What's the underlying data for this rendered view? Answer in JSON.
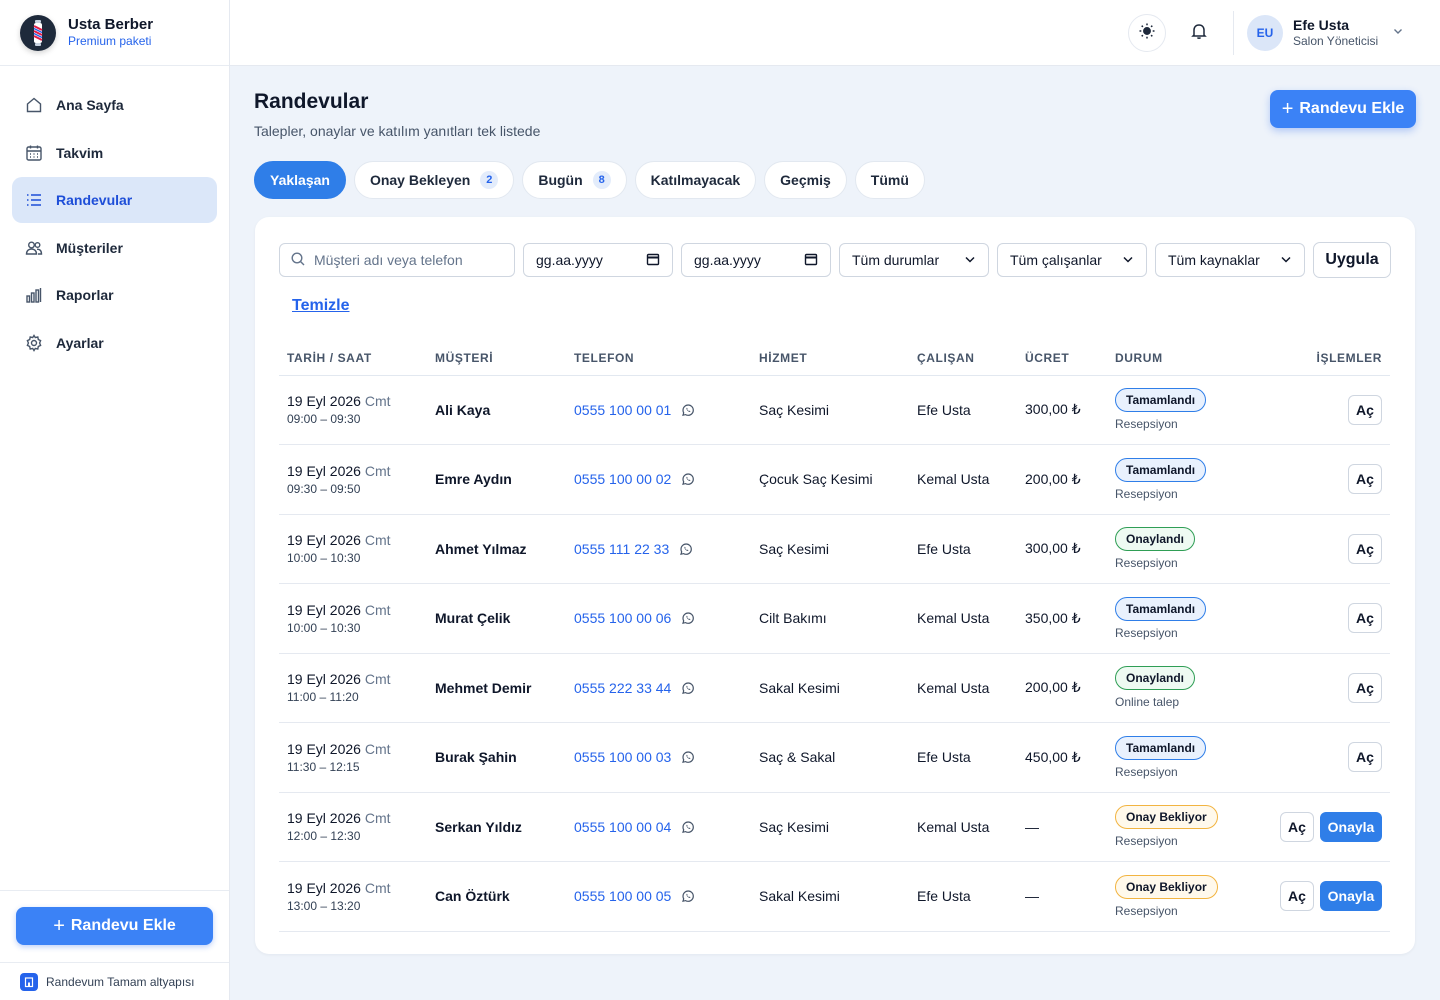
{
  "brand": {
    "name": "Usta Berber",
    "plan": "Premium paketi"
  },
  "sidebar": {
    "items": [
      {
        "label": "Ana Sayfa",
        "icon": "home-icon"
      },
      {
        "label": "Takvim",
        "icon": "calendar-icon"
      },
      {
        "label": "Randevular",
        "icon": "list-icon",
        "active": true
      },
      {
        "label": "Müşteriler",
        "icon": "users-icon"
      },
      {
        "label": "Raporlar",
        "icon": "bar-chart-icon"
      },
      {
        "label": "Ayarlar",
        "icon": "gear-icon"
      }
    ],
    "add_button": "Randevu Ekle",
    "footer": "Randevum Tamam altyapısı"
  },
  "topbar": {
    "user": {
      "initials": "EU",
      "name": "Efe Usta",
      "role": "Salon Yöneticisi"
    }
  },
  "page": {
    "title": "Randevular",
    "subtitle": "Talepler, onaylar ve katılım yanıtları tek listede",
    "add_button": "Randevu Ekle"
  },
  "tabs": [
    {
      "label": "Yaklaşan",
      "active": true
    },
    {
      "label": "Onay Bekleyen",
      "count": "2"
    },
    {
      "label": "Bugün",
      "count": "8"
    },
    {
      "label": "Katılmayacak"
    },
    {
      "label": "Geçmiş"
    },
    {
      "label": "Tümü"
    }
  ],
  "filters": {
    "search_placeholder": "Müşteri adı veya telefon",
    "date_from": "gg.aa.yyyy",
    "date_to": "gg.aa.yyyy",
    "status": "Tüm durumlar",
    "staff": "Tüm çalışanlar",
    "source": "Tüm kaynaklar",
    "apply": "Uygula",
    "clear": "Temizle"
  },
  "table": {
    "columns": [
      "TARİH / SAAT",
      "MÜŞTERİ",
      "TELEFON",
      "HİZMET",
      "ÇALIŞAN",
      "ÜCRET",
      "DURUM",
      "İŞLEMLER"
    ],
    "open_label": "Aç",
    "approve_label": "Onayla",
    "rows": [
      {
        "date": "19 Eyl 2026",
        "day": "Cmt",
        "time": "09:00 – 09:30",
        "customer": "Ali Kaya",
        "phone": "0555 100 00 01",
        "service": "Saç Kesimi",
        "staff": "Efe Usta",
        "price": "300,00 ₺",
        "status": "Tamamlandı",
        "status_color": "blue",
        "source": "Resepsiyon",
        "approve": false
      },
      {
        "date": "19 Eyl 2026",
        "day": "Cmt",
        "time": "09:30 – 09:50",
        "customer": "Emre Aydın",
        "phone": "0555 100 00 02",
        "service": "Çocuk Saç Kesimi",
        "staff": "Kemal Usta",
        "price": "200,00 ₺",
        "status": "Tamamlandı",
        "status_color": "blue",
        "source": "Resepsiyon",
        "approve": false
      },
      {
        "date": "19 Eyl 2026",
        "day": "Cmt",
        "time": "10:00 – 10:30",
        "customer": "Ahmet Yılmaz",
        "phone": "0555 111 22 33",
        "service": "Saç Kesimi",
        "staff": "Efe Usta",
        "price": "300,00 ₺",
        "status": "Onaylandı",
        "status_color": "green",
        "source": "Resepsiyon",
        "approve": false
      },
      {
        "date": "19 Eyl 2026",
        "day": "Cmt",
        "time": "10:00 – 10:30",
        "customer": "Murat Çelik",
        "phone": "0555 100 00 06",
        "service": "Cilt Bakımı",
        "staff": "Kemal Usta",
        "price": "350,00 ₺",
        "status": "Tamamlandı",
        "status_color": "blue",
        "source": "Resepsiyon",
        "approve": false
      },
      {
        "date": "19 Eyl 2026",
        "day": "Cmt",
        "time": "11:00 – 11:20",
        "customer": "Mehmet Demir",
        "phone": "0555 222 33 44",
        "service": "Sakal Kesimi",
        "staff": "Kemal Usta",
        "price": "200,00 ₺",
        "status": "Onaylandı",
        "status_color": "green",
        "source": "Online talep",
        "approve": false
      },
      {
        "date": "19 Eyl 2026",
        "day": "Cmt",
        "time": "11:30 – 12:15",
        "customer": "Burak Şahin",
        "phone": "0555 100 00 03",
        "service": "Saç & Sakal",
        "staff": "Efe Usta",
        "price": "450,00 ₺",
        "status": "Tamamlandı",
        "status_color": "blue",
        "source": "Resepsiyon",
        "approve": false
      },
      {
        "date": "19 Eyl 2026",
        "day": "Cmt",
        "time": "12:00 – 12:30",
        "customer": "Serkan Yıldız",
        "phone": "0555 100 00 04",
        "service": "Saç Kesimi",
        "staff": "Kemal Usta",
        "price": "—",
        "status": "Onay Bekliyor",
        "status_color": "amber",
        "source": "Resepsiyon",
        "approve": true
      },
      {
        "date": "19 Eyl 2026",
        "day": "Cmt",
        "time": "13:00 – 13:20",
        "customer": "Can Öztürk",
        "phone": "0555 100 00 05",
        "service": "Sakal Kesimi",
        "staff": "Efe Usta",
        "price": "—",
        "status": "Onay Bekliyor",
        "status_color": "amber",
        "source": "Resepsiyon",
        "approve": true
      }
    ]
  },
  "colors": {
    "accent": "#2f7ee8",
    "background": "#eef3fa",
    "success": "#2f9e55",
    "warning": "#f2b441"
  }
}
